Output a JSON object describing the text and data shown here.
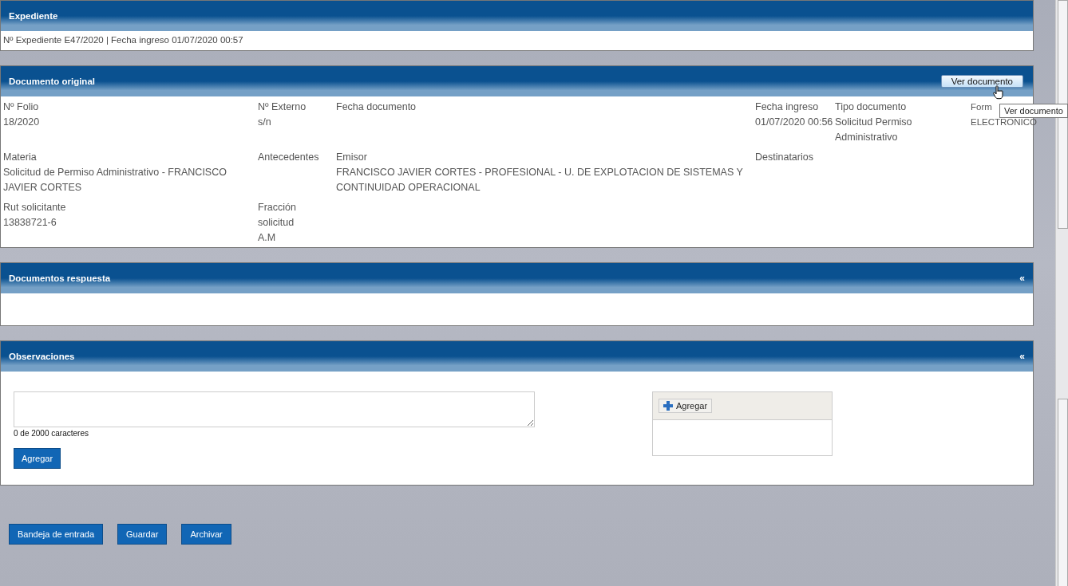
{
  "expediente": {
    "title": "Expediente",
    "summary": "Nº Expediente E47/2020 | Fecha ingreso 01/07/2020 00:57"
  },
  "documento_original": {
    "title": "Documento original",
    "view_button": "Ver documento",
    "tooltip": "Ver documento",
    "rows": [
      [
        {
          "label": "Nº Folio",
          "value": "18/2020"
        },
        {
          "label": "Nº Externo",
          "value": "s/n"
        },
        {
          "label": "Fecha documento"
        },
        {
          "label": "Fecha ingreso",
          "value": "01/07/2020 00:56"
        },
        {
          "label": "Tipo documento",
          "value": "Solicitud Permiso Administrativo"
        },
        {
          "label": "Form",
          "value": "ELECTRONICO"
        }
      ],
      [
        {
          "label": "Materia",
          "value": "Solicitud de Permiso Administrativo - FRANCISCO JAVIER CORTES"
        },
        {
          "label": "Antecedentes"
        },
        {
          "label": "Emisor",
          "value": "FRANCISCO JAVIER CORTES - PROFESIONAL - U. DE EXPLOTACION DE SISTEMAS Y CONTINUIDAD OPERACIONAL"
        },
        {
          "label": "Destinatarios"
        }
      ],
      [
        {
          "label": "Rut solicitante",
          "value": "13838721-6"
        },
        {
          "label": "Fracción solicitud",
          "value": "A.M"
        }
      ]
    ]
  },
  "documentos_respuesta": {
    "title": "Documentos respuesta",
    "collapse": "«"
  },
  "observaciones": {
    "title": "Observaciones",
    "collapse": "«",
    "counter": "0 de 2000 caracteres",
    "add_button": "Agregar",
    "attach_button": "Agregar"
  },
  "actions": [
    "Bandeja de entrada",
    "Guardar",
    "Archivar"
  ]
}
